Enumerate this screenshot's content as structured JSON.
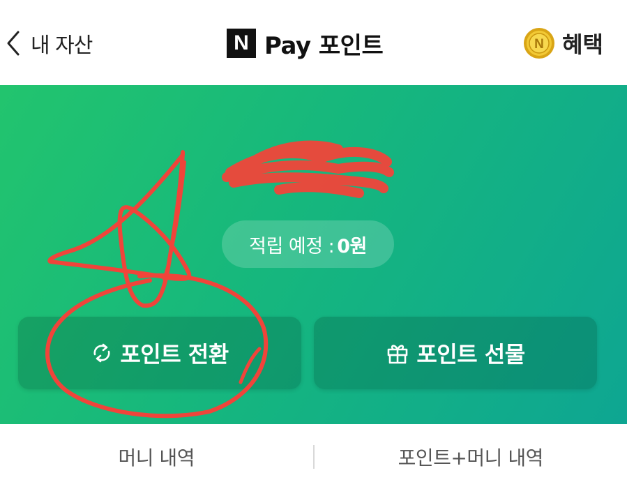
{
  "header": {
    "back_label": "내 자산",
    "logo_letter": "N",
    "title": "Pay 포인트",
    "benefit_label": "혜택"
  },
  "panel": {
    "pending_label": "적립 예정 :",
    "pending_amount": "0원",
    "actions": [
      {
        "label": "포인트 전환",
        "icon": "refresh-icon"
      },
      {
        "label": "포인트 선물",
        "icon": "gift-icon"
      }
    ]
  },
  "tabs": [
    {
      "label": "머니 내역"
    },
    {
      "label": "포인트+머니 내역"
    }
  ],
  "colors": {
    "panel_start": "#22c46e",
    "panel_end": "#0ea692",
    "annotation_red": "#f0443a"
  }
}
